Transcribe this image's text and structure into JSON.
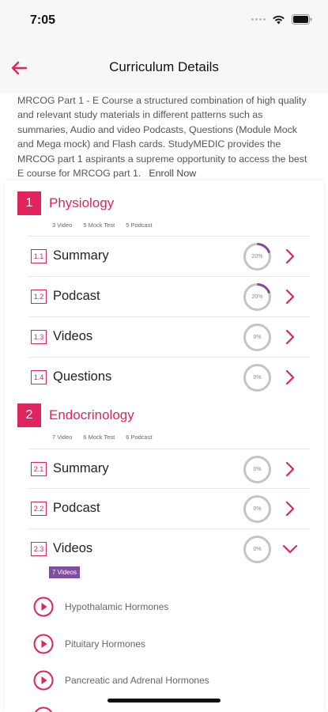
{
  "status_bar": {
    "time": "7:05"
  },
  "nav": {
    "title": "Curriculum Details"
  },
  "intro": {
    "text": "MRCOG Part 1 - E Course a structured combination of high quality and relevant study materials in different patterns such as summaries, Audio and video Podcasts, Questions (Module Mock and Mega mock) and Flash cards. StudyMEDIC provides the MRCOG part 1 aspirants a supreme opportunity to access the best E course for MRCOG part 1.",
    "enroll": "Enroll Now"
  },
  "sections": [
    {
      "number": "1",
      "title": "Physiology",
      "meta": {
        "videos": "3 Video",
        "mock": "5 Mock Test",
        "podcast": "5 Podcast"
      },
      "rows": [
        {
          "number": "1.1",
          "label": "Summary",
          "progress": 20,
          "progress_text": "20%"
        },
        {
          "number": "1.2",
          "label": "Podcast",
          "progress": 20,
          "progress_text": "20%"
        },
        {
          "number": "1.3",
          "label": "Videos",
          "progress": 0,
          "progress_text": "0%"
        },
        {
          "number": "1.4",
          "label": "Questions",
          "progress": 0,
          "progress_text": "0%"
        }
      ]
    },
    {
      "number": "2",
      "title": "Endocrinology",
      "meta": {
        "videos": "7 Video",
        "mock": "6 Mock Test",
        "podcast": "6 Podcast"
      },
      "rows": [
        {
          "number": "2.1",
          "label": "Summary",
          "progress": 0,
          "progress_text": "0%"
        },
        {
          "number": "2.2",
          "label": "Podcast",
          "progress": 0,
          "progress_text": "0%"
        },
        {
          "number": "2.3",
          "label": "Videos",
          "progress": 0,
          "progress_text": "0%",
          "expanded": true
        }
      ]
    }
  ],
  "videos_badge": "7 Videos",
  "video_list": [
    "Hypothalamic Hormones",
    "Pituitary Hormones",
    "Pancreatic and Adrenal Hormones"
  ],
  "colors": {
    "accent": "#e0245e",
    "progress_fill": "#7e4d9e",
    "progress_track": "#c4c4c4",
    "badge": "#7e4d9e"
  },
  "icons": {
    "back": "arrow-left-icon",
    "row": "chevron-right-icon",
    "expanded_row": "chevron-down-icon",
    "video": "play-circle-icon",
    "wifi": "wifi-icon",
    "battery": "battery-icon",
    "signal": "signal-icon"
  }
}
